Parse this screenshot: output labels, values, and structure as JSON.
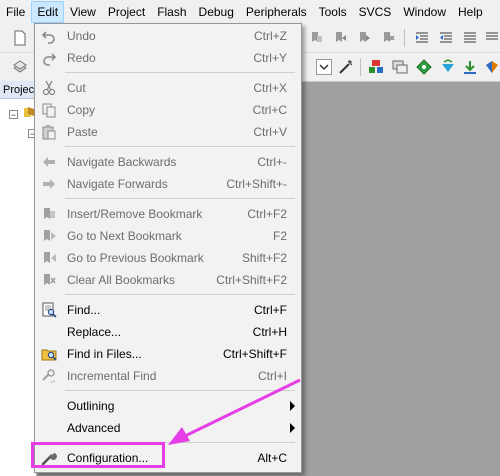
{
  "menubar": {
    "items": [
      {
        "label": "File"
      },
      {
        "label": "Edit",
        "active": true
      },
      {
        "label": "View"
      },
      {
        "label": "Project"
      },
      {
        "label": "Flash"
      },
      {
        "label": "Debug"
      },
      {
        "label": "Peripherals"
      },
      {
        "label": "Tools"
      },
      {
        "label": "SVCS"
      },
      {
        "label": "Window"
      },
      {
        "label": "Help"
      }
    ]
  },
  "project_panel": {
    "tab_label": "Project"
  },
  "edit_menu": {
    "items": [
      {
        "label": "Undo",
        "shortcut": "Ctrl+Z",
        "icon": "undo-icon",
        "enabled": false
      },
      {
        "label": "Redo",
        "shortcut": "Ctrl+Y",
        "icon": "redo-icon",
        "enabled": false
      },
      {
        "label": "Cut",
        "shortcut": "Ctrl+X",
        "icon": "scissors-icon",
        "enabled": false
      },
      {
        "label": "Copy",
        "shortcut": "Ctrl+C",
        "icon": "copy-icon",
        "enabled": false
      },
      {
        "label": "Paste",
        "shortcut": "Ctrl+V",
        "icon": "paste-icon",
        "enabled": false
      },
      {
        "label": "Navigate Backwards",
        "shortcut": "Ctrl+-",
        "icon": "arrow-left-icon",
        "enabled": false
      },
      {
        "label": "Navigate Forwards",
        "shortcut": "Ctrl+Shift+-",
        "icon": "arrow-right-icon",
        "enabled": false
      },
      {
        "label": "Insert/Remove Bookmark",
        "shortcut": "Ctrl+F2",
        "icon": "bookmark-toggle-icon",
        "enabled": false
      },
      {
        "label": "Go to Next Bookmark",
        "shortcut": "F2",
        "icon": "bookmark-next-icon",
        "enabled": false
      },
      {
        "label": "Go to Previous Bookmark",
        "shortcut": "Shift+F2",
        "icon": "bookmark-prev-icon",
        "enabled": false
      },
      {
        "label": "Clear All Bookmarks",
        "shortcut": "Ctrl+Shift+F2",
        "icon": "bookmark-clear-icon",
        "enabled": false
      },
      {
        "label": "Find...",
        "shortcut": "Ctrl+F",
        "icon": "find-icon",
        "enabled": true
      },
      {
        "label": "Replace...",
        "shortcut": "Ctrl+H",
        "icon": "",
        "enabled": true
      },
      {
        "label": "Find in Files...",
        "shortcut": "Ctrl+Shift+F",
        "icon": "find-in-files-icon",
        "enabled": true
      },
      {
        "label": "Incremental Find",
        "shortcut": "Ctrl+I",
        "icon": "incremental-find-icon",
        "enabled": false
      },
      {
        "label": "Outlining",
        "shortcut": "",
        "icon": "",
        "enabled": true,
        "submenu": true
      },
      {
        "label": "Advanced",
        "shortcut": "",
        "icon": "",
        "enabled": true,
        "submenu": true
      },
      {
        "label": "Configuration...",
        "shortcut": "Alt+C",
        "icon": "wrench-icon",
        "enabled": true
      }
    ]
  },
  "annotation": {
    "color": "#e63ee6"
  }
}
